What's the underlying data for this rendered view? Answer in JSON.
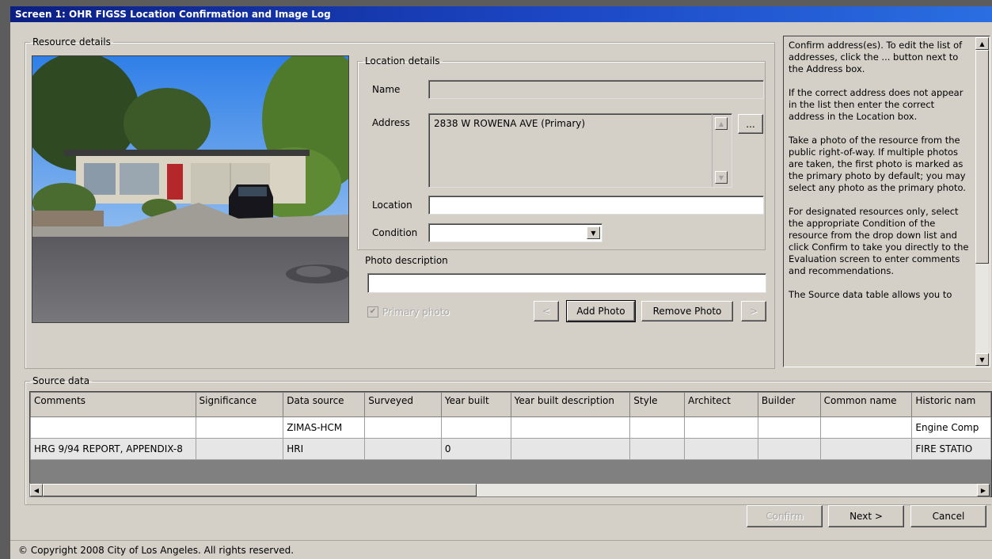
{
  "window": {
    "title": "Screen 1: OHR FIGSS Location Confirmation and Image Log"
  },
  "resource_details": {
    "legend": "Resource details",
    "location_details": {
      "legend": "Location details",
      "name_label": "Name",
      "name_value": "",
      "address_label": "Address",
      "address_value": "2838 W ROWENA AVE (Primary)",
      "address_more_button": "...",
      "location_label": "Location",
      "location_value": "",
      "condition_label": "Condition",
      "condition_value": ""
    },
    "photo_description_label": "Photo description",
    "photo_description_value": "",
    "primary_photo_label": "Primary photo",
    "primary_photo_checked": true,
    "prev_button": "<",
    "add_photo_button": "Add Photo",
    "remove_photo_button": "Remove Photo",
    "next_photo_button": ">"
  },
  "help": {
    "paragraphs": [
      "Confirm address(es). To edit the list of addresses, click the ... button next to the Address box.",
      "If the correct address does not appear in the list then enter the correct address in the Location box.",
      "Take a photo of the resource from the public right-of-way. If multiple photos are taken, the first photo is marked as the primary photo by default; you may select any photo as the primary photo.",
      "For designated resources only, select the appropriate Condition of the resource from the drop down list and click Confirm to take you directly to the Evaluation screen to enter comments and recommendations.",
      "The Source data table allows you to"
    ]
  },
  "source_data": {
    "legend": "Source data",
    "columns": [
      "Comments",
      "Significance",
      "Data source",
      "Surveyed",
      "Year built",
      "Year built description",
      "Style",
      "Architect",
      "Builder",
      "Common name",
      "Historic nam"
    ],
    "rows": [
      [
        "",
        "",
        "ZIMAS-HCM",
        "",
        "",
        "",
        "",
        "",
        "",
        "",
        "Engine Comp"
      ],
      [
        "HRG 9/94 REPORT, APPENDIX-8",
        "",
        "HRI",
        "",
        "0",
        "",
        "",
        "",
        "",
        "",
        "FIRE STATIO"
      ]
    ]
  },
  "actions": {
    "confirm": "Confirm",
    "next": "Next >",
    "cancel": "Cancel"
  },
  "footer": {
    "copyright": "© Copyright 2008 City of Los Angeles. All rights reserved."
  }
}
